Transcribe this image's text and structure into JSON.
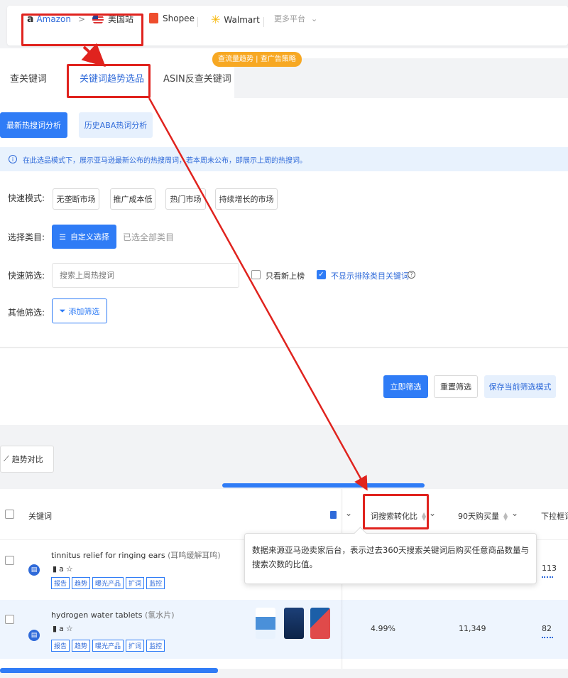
{
  "platforms": {
    "amazon": "Amazon",
    "separator": ">",
    "site": "美国站",
    "shopee": "Shopee",
    "walmart": "Walmart",
    "more": "更多平台"
  },
  "tabs": {
    "badge": "查流量趋势 | 查广告策略",
    "items": [
      "查关键词",
      "关键词趋势选品",
      "ASIN反查关键词"
    ]
  },
  "subtabs": [
    "最新热搜词分析",
    "历史ABA热词分析"
  ],
  "info": "在此选品模式下，展示亚马逊最新公布的热搜周词，若本周未公布，即展示上周的热搜词。",
  "filters": {
    "quick_mode_label": "快速模式:",
    "quick_modes": [
      "无垄断市场",
      "推广成本低",
      "热门市场",
      "持续增长的市场"
    ],
    "category_label": "选择类目:",
    "category_button": "自定义选择",
    "category_selected": "已选全部类目",
    "quick_filter_label": "快速筛选:",
    "search_placeholder": "搜索上周热搜词",
    "only_new": "只看新上榜",
    "hide_excluded": "不显示排除类目关键词",
    "other_label": "其他筛选:",
    "add_filter": "添加筛选"
  },
  "actions": {
    "apply": "立即筛选",
    "reset": "重置筛选",
    "save": "保存当前筛选模式"
  },
  "toolbar": {
    "compare": "趋势对比"
  },
  "table": {
    "headers": {
      "keyword": "关键词",
      "conversion": "词搜索转化比",
      "purchases": "90天购买量",
      "dropdown": "下拉框词"
    },
    "tags": [
      "报告",
      "趋势",
      "曝光产品",
      "扩词",
      "监控"
    ],
    "rows": [
      {
        "keyword": "tinnitus relief for ringing ears",
        "cn": "(耳鸣缓解耳鸣)",
        "conversion": "",
        "purchases": "",
        "dropdown": "113"
      },
      {
        "keyword": "hydrogen water tablets",
        "cn": "(氢水片)",
        "conversion": "4.99%",
        "purchases": "11,349",
        "dropdown": "82"
      }
    ]
  },
  "tooltip": "数据来源亚马逊卖家后台，表示过去360天搜索关键词后购买任意商品数量与搜索次数的比值。",
  "colors": {
    "accent": "#2f7cf6",
    "annotation": "#e0231e",
    "badge": "#f7a823"
  }
}
